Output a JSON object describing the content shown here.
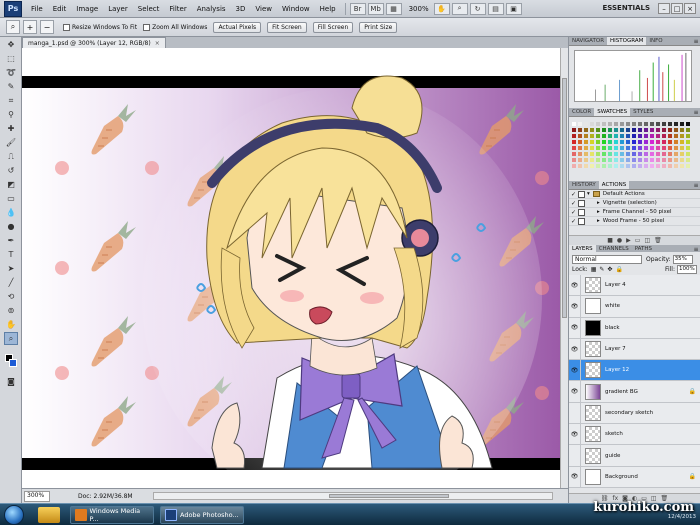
{
  "menubar": {
    "logo": "Ps",
    "items": [
      "File",
      "Edit",
      "Image",
      "Layer",
      "Select",
      "Filter",
      "Analysis",
      "3D",
      "View",
      "Window",
      "Help"
    ],
    "zoom": "300%",
    "workspace": "ESSENTIALS",
    "win_minimize": "–",
    "win_maximize": "□",
    "win_close": "×"
  },
  "options": {
    "resize_windows": "Resize Windows To Fit",
    "zoom_all": "Zoom All Windows",
    "actual_pixels": "Actual Pixels",
    "fit_screen": "Fit Screen",
    "fill_screen": "Fill Screen",
    "print_size": "Print Size"
  },
  "document": {
    "tab_title": "manga_1.psd @ 300% (Layer 12, RGB/8)",
    "close": "×"
  },
  "status": {
    "zoom": "300%",
    "doc_info": "Doc: 2.92M/36.8M"
  },
  "panels": {
    "histogram_tabs": [
      "NAVIGATOR",
      "HISTOGRAM",
      "INFO"
    ],
    "swatch_tabs": [
      "COLOR",
      "SWATCHES",
      "STYLES"
    ],
    "action_tabs": [
      "HISTORY",
      "ACTIONS"
    ],
    "actions": [
      "Default Actions",
      "Vignette (selection)",
      "Frame Channel - 50 pixel",
      "Wood Frame - 50 pixel"
    ],
    "layer_tabs": [
      "LAYERS",
      "CHANNELS",
      "PATHS"
    ],
    "blend_mode": "Normal",
    "opacity_label": "Opacity:",
    "opacity": "35%",
    "lock_label": "Lock:",
    "fill_label": "Fill:",
    "fill": "100%",
    "layers": [
      {
        "name": "Layer 4",
        "thumb": "trans",
        "visible": true
      },
      {
        "name": "white",
        "thumb": "white",
        "visible": true
      },
      {
        "name": "black",
        "thumb": "black",
        "visible": true
      },
      {
        "name": "Layer 7",
        "thumb": "trans",
        "visible": true
      },
      {
        "name": "Layer 12",
        "thumb": "trans",
        "visible": true,
        "selected": true
      },
      {
        "name": "gradient BG",
        "thumb": "grad",
        "visible": true
      },
      {
        "name": "secondary sketch",
        "thumb": "trans",
        "visible": false
      },
      {
        "name": "sketch",
        "thumb": "trans",
        "visible": true
      },
      {
        "name": "guide",
        "thumb": "trans",
        "visible": false
      },
      {
        "name": "Background",
        "thumb": "white",
        "visible": true
      }
    ]
  },
  "taskbar": {
    "btn1": "Windows Media P...",
    "btn2": "Adobe Photosho...",
    "clock": "12/4/2013"
  },
  "watermark": "kurohiko.com"
}
